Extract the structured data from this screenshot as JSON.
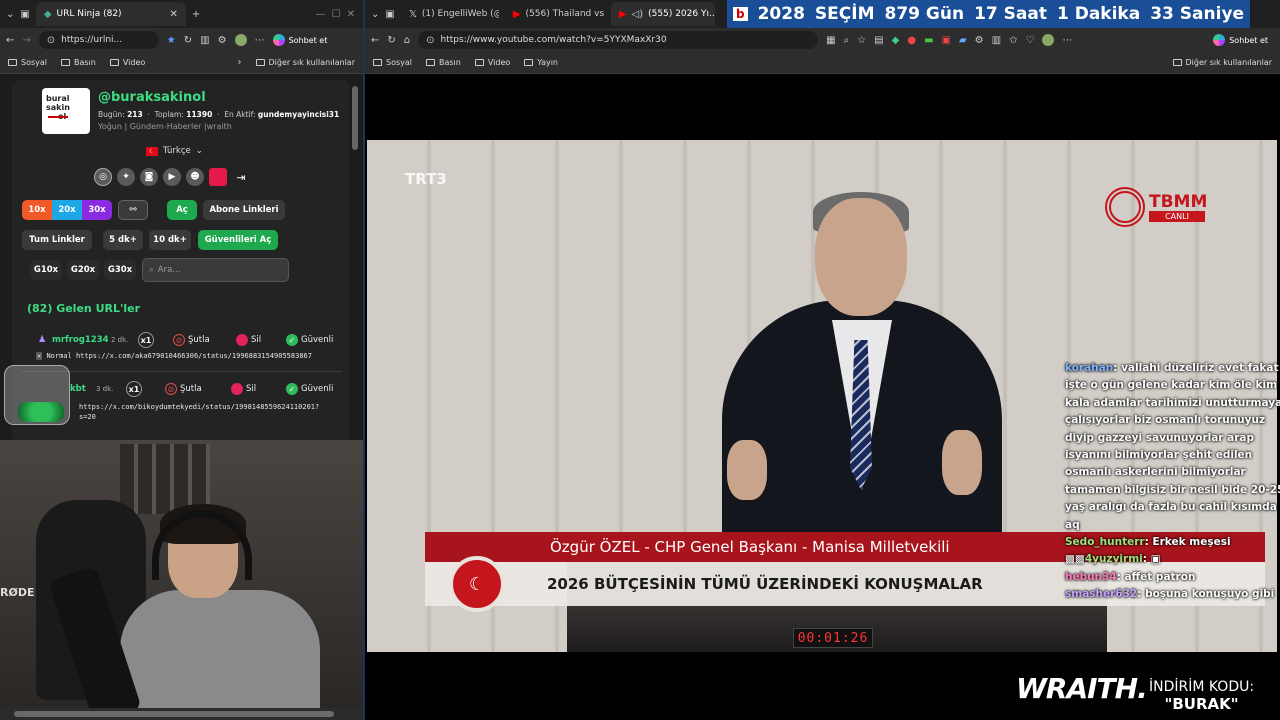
{
  "left_browser": {
    "tab_title": "URL Ninja (82)",
    "url": "https://urlni...",
    "sohbet": "Sohbet et",
    "bookmarks": [
      "Sosyal",
      "Basın",
      "Video"
    ],
    "other_bookmarks": "Diğer sık kullanılanlar"
  },
  "panel": {
    "logo_lines": [
      "bural",
      "sakin",
      "ol"
    ],
    "username": "@buraksakinol",
    "stats_today_label": "Bugün:",
    "stats_today": "213",
    "stats_total_label": "Toplam:",
    "stats_total": "11390",
    "stats_active_label": "En Aktif:",
    "stats_active": "gundemyayincisi31",
    "description": "Yoğun | Gündem-Haberler |wraith",
    "language": "Türkçe",
    "buttons": {
      "b10x": "10x",
      "b20x": "20x",
      "b30x": "30x",
      "ac": "Aç",
      "abone": "Abone Linkleri",
      "tum": "Tum Linkler",
      "d5": "5 dk+",
      "d10": "10 dk+",
      "guvenli_ac": "Güvenlileri Aç",
      "g10": "G10x",
      "g20": "G20x",
      "g30": "G30x"
    },
    "search_placeholder": "Ara...",
    "section_title": "(82) Gelen URL'ler",
    "rows": [
      {
        "user": "mrfrog1234",
        "ago": "2 dk.",
        "count": "x1",
        "sutla": "Şutla",
        "sil": "Sil",
        "guvenli": "Güvenli",
        "prefix": "Normal",
        "link": "https://x.com/aka679010466306/status/1996883154905583867"
      },
      {
        "user": "kbt",
        "ago": "3 dk.",
        "count": "x1",
        "sutla": "Şutla",
        "sil": "Sil",
        "guvenli": "Güvenli",
        "prefix": "",
        "link": "https://x.com/bikoydumtekyedi/status/1998148559624110201?",
        "link2": "s=20"
      }
    ]
  },
  "webcam": {
    "brand": "RØDE"
  },
  "right_browser": {
    "tabs": [
      "(1) EngelliWeb (@...",
      "(556) Thailand vs ...",
      "(555) 2026 Yı..."
    ],
    "ticker": [
      "2028",
      "SEÇİM",
      "879 Gün",
      "17 Saat",
      "1 Dakika",
      "33 Saniye"
    ],
    "url": "https://www.youtube.com/watch?v=5YYXMaxXr30",
    "sohbet": "Sohbet et",
    "bookmarks": [
      "Sosyal",
      "Basın",
      "Video",
      "Yayın"
    ],
    "other_bookmarks": "Diğer sık kullanılanlar"
  },
  "video": {
    "channel_logo": "TRT3",
    "tbmm": "TBMM",
    "canli": "CANLI",
    "lower_third_name": "Özgür ÖZEL - CHP Genel Başkanı - Manisa Milletvekili",
    "lower_third_title": "2026 BÜTÇESİNİN TÜMÜ ÜZERİNDEKİ KONUŞMALAR",
    "clock": "00:01:26"
  },
  "chat": [
    {
      "name": "korahan",
      "color": "#7fb3ff",
      "text": "vallahi düzeliriz evet fakat işte o gün gelene kadar kim öle kim kala adamlar tarihimizi unutturmaya çalışıyorlar biz osmanlı torunuyuz diyip gazzeyi savunuyorlar arap isyanını bilmiyorlar şehit edilen osmanlı askerlerini bilmiyorlar tamamen bilgisiz bir nesil bide 20-25 yaş aralığı da fazla bu cahil kısımda aq"
    },
    {
      "name": "Sedo_hunterr",
      "color": "#9ee37d",
      "text": "Erkek meşesi"
    },
    {
      "name": "4yuzyirmi",
      "color": "#9ee37d",
      "text": ""
    },
    {
      "name": "hebun34",
      "color": "#ff7ab8",
      "text": "affet patron"
    },
    {
      "name": "smasher632",
      "color": "#c5a3ff",
      "text": "boşuna konuşuyo gibi"
    }
  ],
  "sponsor": {
    "brand": "WRAITH.",
    "code_label": "İNDİRİM KODU:",
    "code": "\"BURAK\""
  }
}
